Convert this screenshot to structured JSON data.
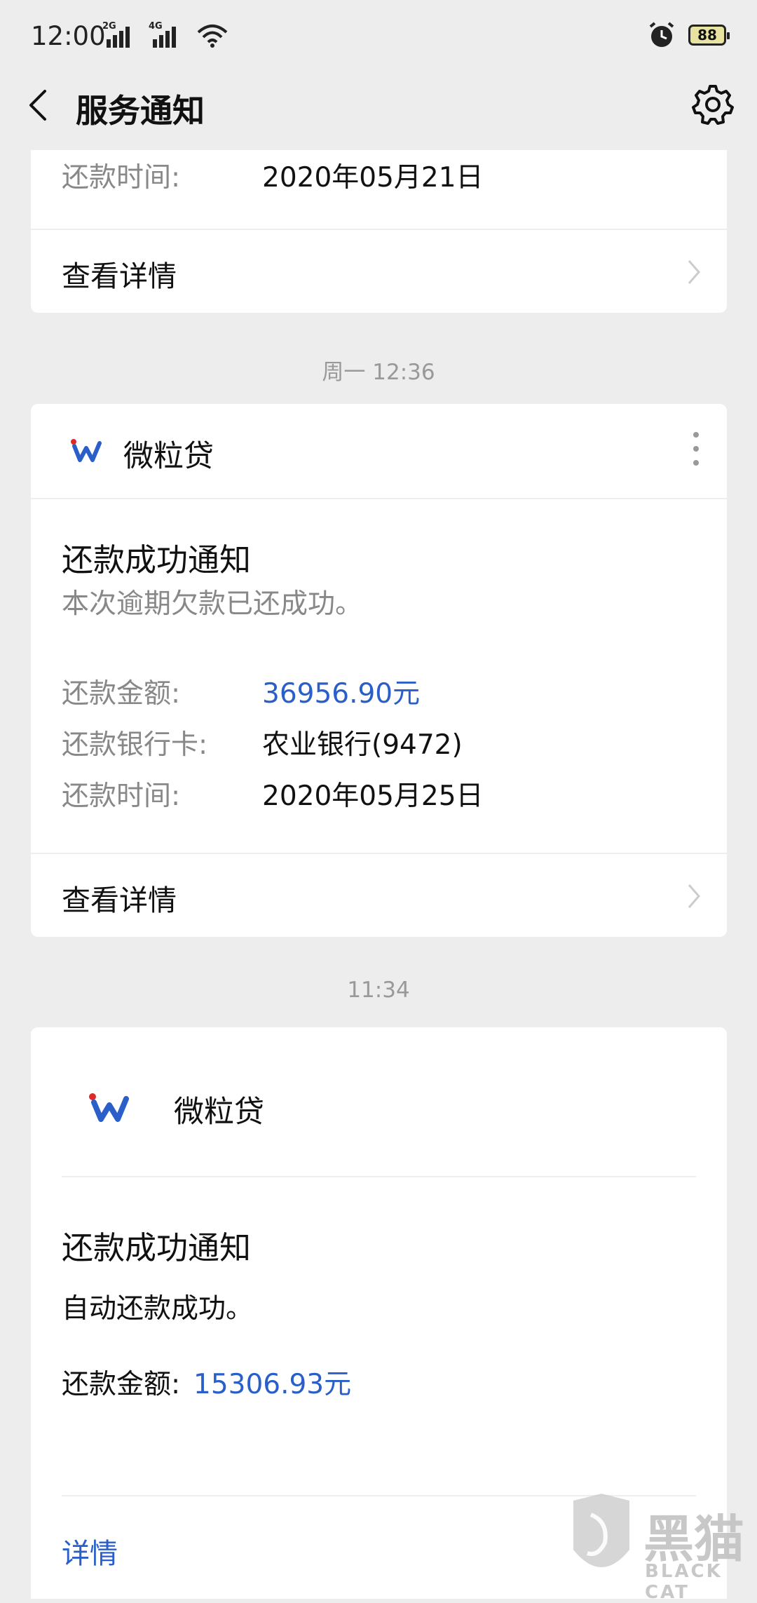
{
  "status": {
    "time": "12:00",
    "signal1": "2G",
    "signal2": "4G",
    "battery": "88"
  },
  "nav": {
    "title": "服务通知"
  },
  "card_prev": {
    "repay_time_label": "还款时间:",
    "repay_time_value": "2020年05月21日",
    "details_label": "查看详情"
  },
  "timestamp1": "周一 12:36",
  "card_one": {
    "brand": "微粒贷",
    "title": "还款成功通知",
    "subtitle": "本次逾期欠款已还成功。",
    "amount_label": "还款金额:",
    "amount_value": "36956.90元",
    "bank_label": "还款银行卡:",
    "bank_value": "农业银行(9472)",
    "time_label": "还款时间:",
    "time_value": "2020年05月25日",
    "details_label": "查看详情"
  },
  "timestamp2": "11:34",
  "card_two": {
    "brand": "微粒贷",
    "title": "还款成功通知",
    "subtitle": "自动还款成功。",
    "amount_label": "还款金额:",
    "amount_value": "15306.93元",
    "details_label": "详情"
  },
  "watermark": {
    "cn": "黑猫",
    "en": "BLACK CAT"
  },
  "colors": {
    "accent_blue": "#2a5ec8",
    "logo_red": "#e02a2a",
    "background": "#ededed"
  }
}
